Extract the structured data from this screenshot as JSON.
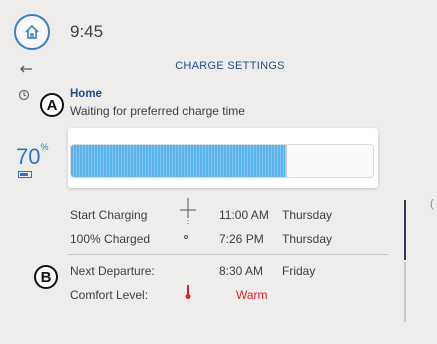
{
  "header": {
    "time": "9:45",
    "title": "CHARGE SETTINGS"
  },
  "location": {
    "name": "Home",
    "status": "Waiting for preferred charge time"
  },
  "battery": {
    "percent_value": "70",
    "percent_sign": "%",
    "charge_fraction": 0.71
  },
  "schedule": [
    {
      "label": "Start Charging",
      "time": "11:00 AM",
      "day": "Thursday"
    },
    {
      "label": "100% Charged",
      "time": "7:26 PM",
      "day": "Thursday"
    }
  ],
  "departure": {
    "label": "Next Departure:",
    "time": "8:30 AM",
    "day": "Friday"
  },
  "comfort": {
    "label": "Comfort Level:",
    "value": "Warm"
  },
  "markers": {
    "a": "A",
    "b": "B"
  },
  "icons": {
    "home": "home-icon",
    "back": "back-arrow-icon",
    "location": "location-pin-icon",
    "battery": "car-battery-icon",
    "timeline": "timeline-icon",
    "thermometer": "thermometer-icon"
  },
  "colors": {
    "accent": "#2c77c4",
    "title": "#1f4f8a",
    "charge_fill": "#5ab2ea",
    "warm": "#d4262c"
  }
}
